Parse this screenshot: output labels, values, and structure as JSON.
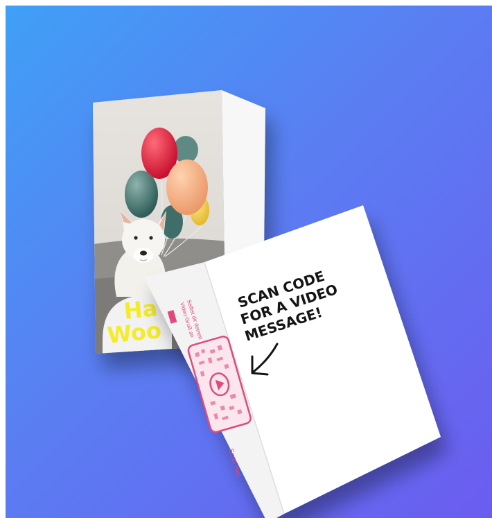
{
  "card": {
    "front_greeting_line1": "Ha",
    "front_greeting_line2": "Woo",
    "inner_side_text_line1": "Selbst dir deinen",
    "inner_side_text_line2": "Video-Gruß an",
    "inner_side_cta": "Scan me!",
    "message_line1": "SCAN CODE",
    "message_line2": "FOR A VIDEO",
    "message_line3": "MESSAGE!"
  },
  "colors": {
    "background_start": "#3fa0f7",
    "background_end": "#6b5cf0",
    "greeting_yellow": "#f4ec2a",
    "qr_pink": "#e04a7c"
  },
  "icons": [
    "arrow-icon",
    "play-icon",
    "qr-code-icon"
  ]
}
